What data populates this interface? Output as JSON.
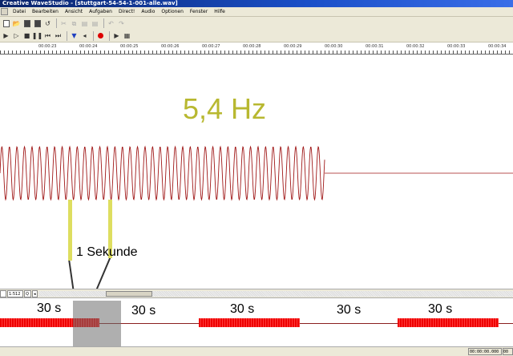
{
  "window": {
    "title": "Creative WaveStudio - [stuttgart-54-54-1-001-alle.wav]"
  },
  "menu": [
    "Datei",
    "Bearbeiten",
    "Ansicht",
    "Aufgaben",
    "Direct!",
    "Audio",
    "Optionen",
    "Fenster",
    "Hilfe"
  ],
  "toolbar1": [
    "new-icon",
    "open-icon",
    "save-icon",
    "save-all-icon",
    "undo-history-icon",
    "cut-icon",
    "copy-icon",
    "paste-icon",
    "paste-mix-icon",
    "undo-icon",
    "redo-icon"
  ],
  "toolbar2": [
    "play-icon",
    "play-selection-icon",
    "stop-icon",
    "pause-icon",
    "rewind-icon",
    "fast-forward-icon",
    "marker-icon",
    "marker-back-icon",
    "record-icon",
    "play-loop-icon",
    "loop-icon"
  ],
  "ruler": {
    "labels": [
      "00:00:23",
      "00:00:24",
      "00:00:25",
      "00:00:26",
      "00:00:27",
      "00:00:28",
      "00:00:29",
      "00:00:30",
      "00:00:31",
      "00:00:32",
      "00:00:33",
      "00:00:34"
    ]
  },
  "annotation": {
    "frequency": "5,4 Hz",
    "interval": "1 Sekunde"
  },
  "zoom": {
    "scale": "1:512",
    "zoom_out": "Q"
  },
  "overview": {
    "segment_labels": [
      "30 s",
      "30 s",
      "30 s",
      "30 s",
      "30 s"
    ]
  },
  "status": {
    "time": "00:00:00.000",
    "extra": "00"
  },
  "colors": {
    "waveform": "#a01818",
    "annotation": "#b8b830",
    "marker": "#dede60",
    "overview_signal": "#e00000"
  }
}
